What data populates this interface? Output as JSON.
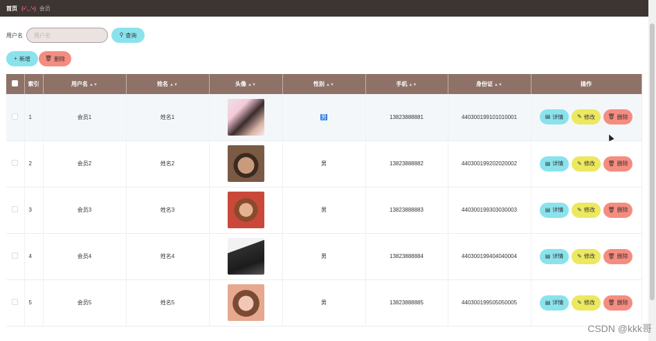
{
  "breadcrumb": {
    "home": "首页",
    "emoji": "(•'◡'•)",
    "current": "会员"
  },
  "search": {
    "label": "用户名",
    "placeholder": "用户名",
    "button": "查询"
  },
  "actions": {
    "add": "新增",
    "delete": "删除"
  },
  "table": {
    "headers": {
      "index": "索引",
      "username": "用户名",
      "name": "姓名",
      "avatar": "头像",
      "gender": "性别",
      "phone": "手机",
      "idcard": "身份证",
      "ops": "操作"
    },
    "rows": [
      {
        "index": "1",
        "username": "会员1",
        "name": "姓名1",
        "gender": "男",
        "phone": "13823888881",
        "idcard": "440300199101010001"
      },
      {
        "index": "2",
        "username": "会员2",
        "name": "姓名2",
        "gender": "男",
        "phone": "13823888882",
        "idcard": "440300199202020002"
      },
      {
        "index": "3",
        "username": "会员3",
        "name": "姓名3",
        "gender": "男",
        "phone": "13823888883",
        "idcard": "440300199303030003"
      },
      {
        "index": "4",
        "username": "会员4",
        "name": "姓名4",
        "gender": "男",
        "phone": "13823888884",
        "idcard": "440300199404040004"
      },
      {
        "index": "5",
        "username": "会员5",
        "name": "姓名5",
        "gender": "男",
        "phone": "13823888885",
        "idcard": "440300199505050005"
      }
    ],
    "row_actions": {
      "detail": "详情",
      "edit": "修改",
      "delete": "删除"
    }
  },
  "watermark": "CSDN @kkk哥",
  "colors": {
    "topbar": "#3d3532",
    "header": "#8e7268",
    "cyan": "#8ae3ec",
    "yellow": "#ece85f",
    "red": "#f58c80"
  }
}
